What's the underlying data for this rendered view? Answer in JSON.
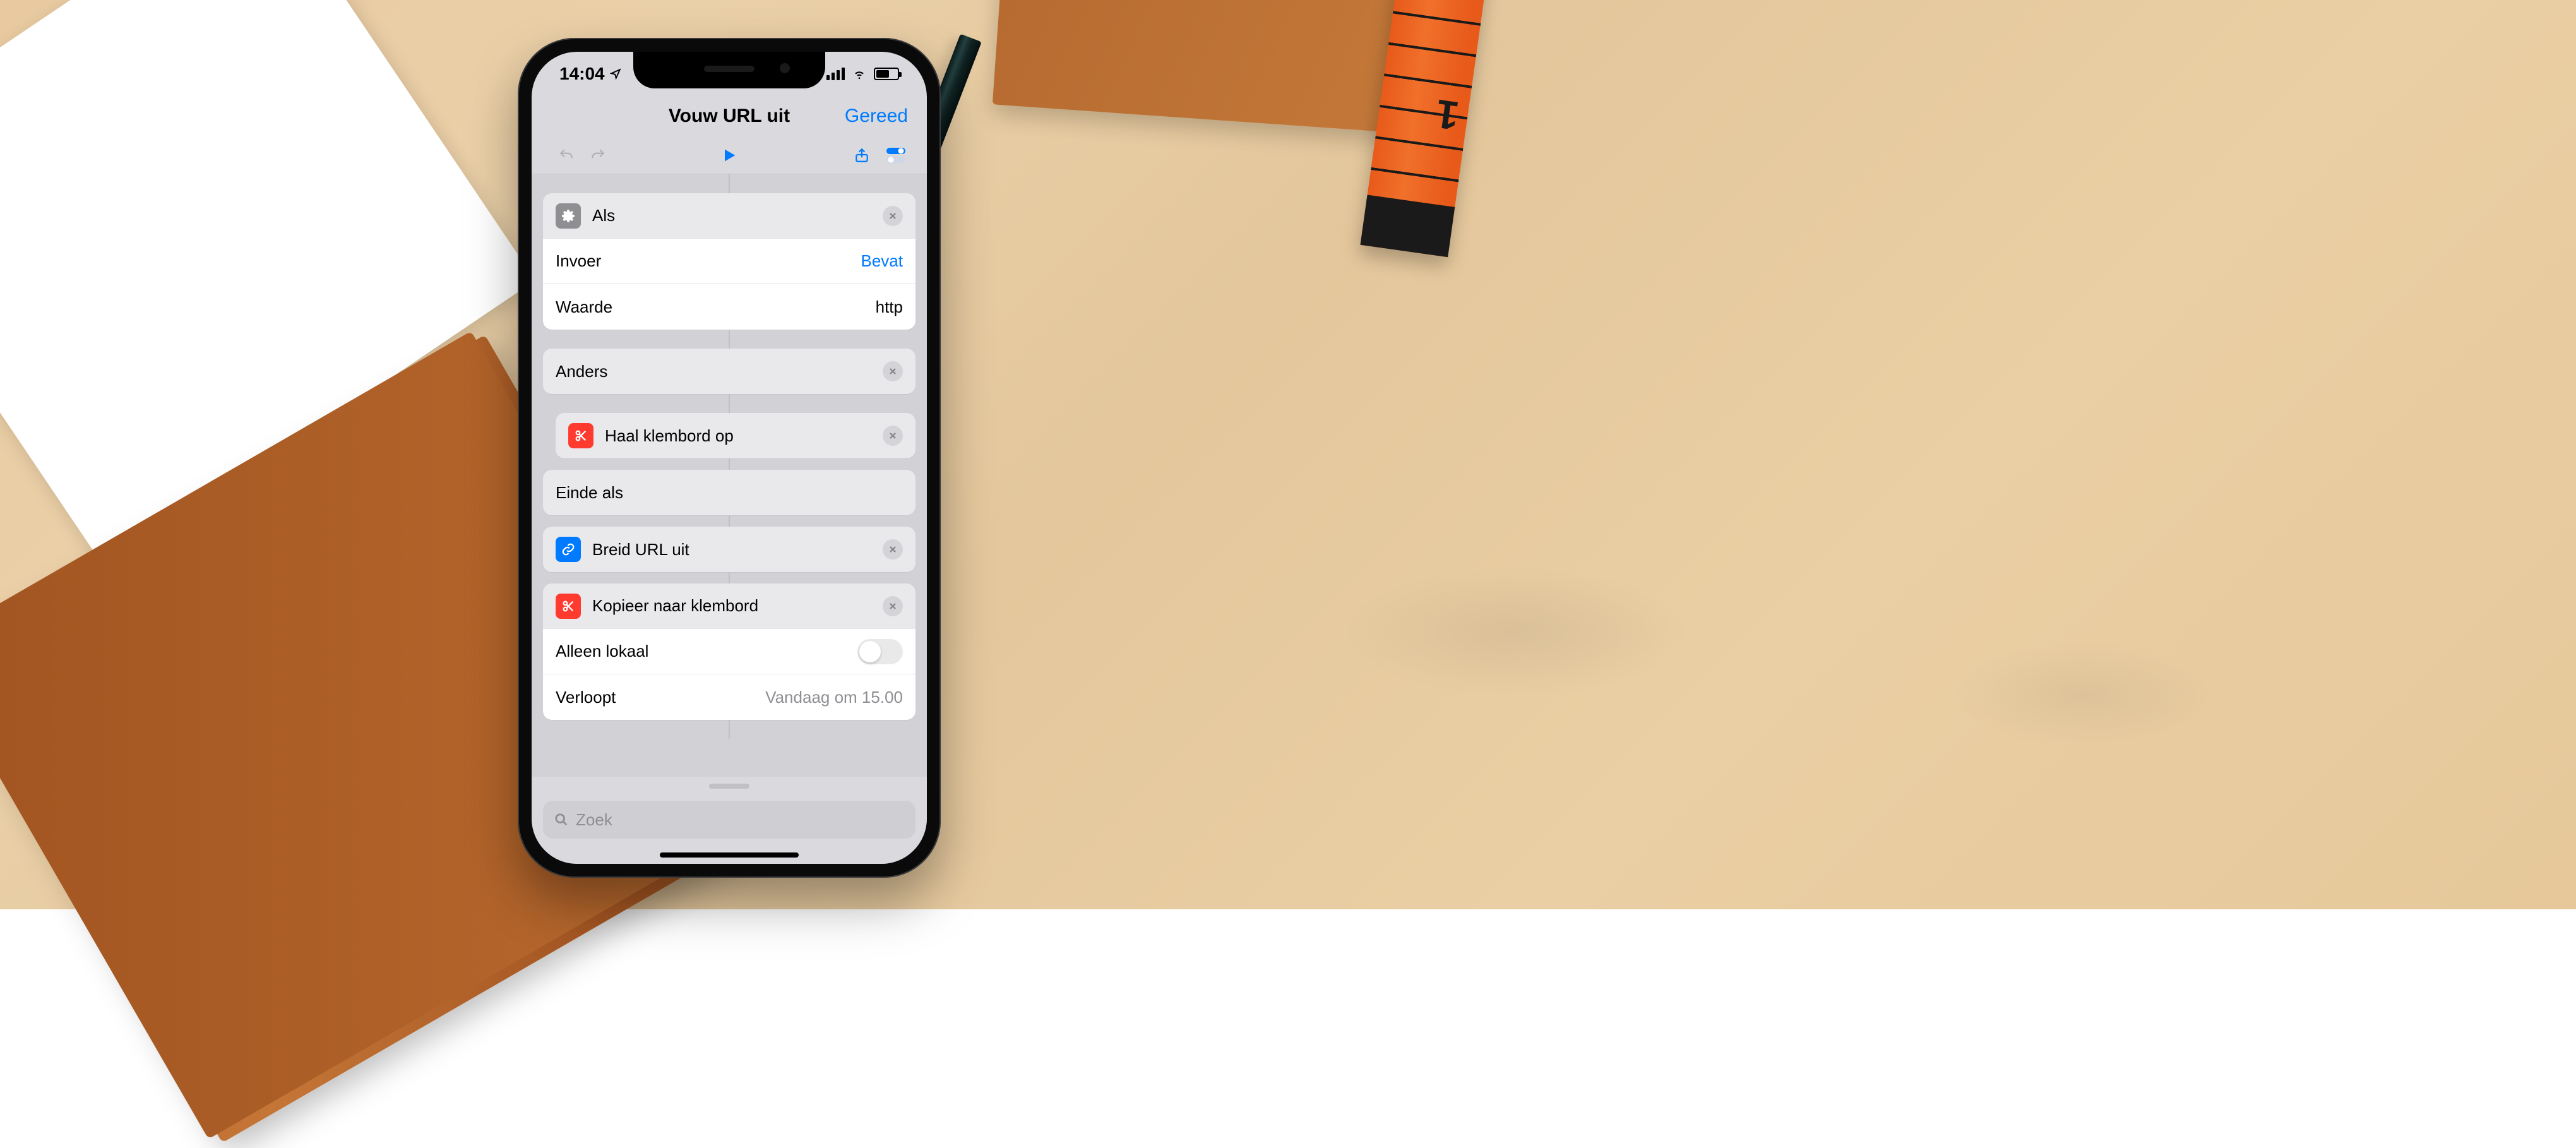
{
  "statusbar": {
    "time": "14:04"
  },
  "navbar": {
    "title": "Vouw URL uit",
    "done": "Gereed"
  },
  "actions": {
    "als": {
      "title": "Als",
      "invoer_label": "Invoer",
      "invoer_value": "Bevat",
      "waarde_label": "Waarde",
      "waarde_value": "http"
    },
    "anders": {
      "title": "Anders"
    },
    "haal_klembord": {
      "title": "Haal klembord op"
    },
    "einde_als": {
      "title": "Einde als"
    },
    "breid_url": {
      "title": "Breid URL uit"
    },
    "kopieer": {
      "title": "Kopieer naar klembord",
      "alleen_lokaal_label": "Alleen lokaal",
      "verloopt_label": "Verloopt",
      "verloopt_value": "Vandaag om 15.00"
    }
  },
  "search": {
    "placeholder": "Zoek"
  }
}
